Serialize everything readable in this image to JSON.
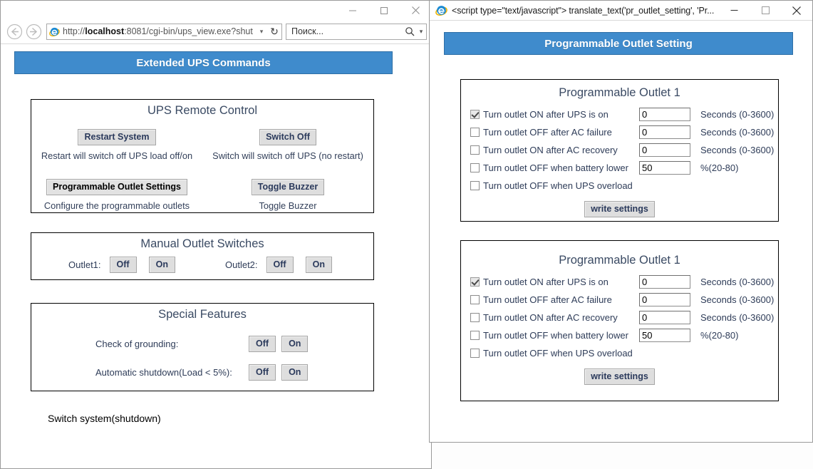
{
  "left_window": {
    "title": "",
    "controls": {
      "minimize": "minimize-icon",
      "maximize": "maximize-icon",
      "close": "close-icon"
    },
    "nav": {
      "back": "back-arrow-icon",
      "forward": "forward-arrow-icon",
      "favicon": "ie-favicon",
      "url_prefix": "http://",
      "url_host": "localhost",
      "url_rest": ":8081/cgi-bin/ups_view.exe?shut",
      "dropdown": "▾",
      "reload": "↻"
    },
    "search": {
      "placeholder": "Поиск...",
      "icon": "search-icon",
      "caret": "▾"
    },
    "page": {
      "banner": "Extended UPS Commands",
      "remote_control": {
        "title": "UPS Remote Control",
        "buttons": [
          {
            "label": "Restart System",
            "caption": "Restart will switch off UPS load off/on",
            "focused": false
          },
          {
            "label": "Switch Off",
            "caption": "Switch will switch off UPS (no restart)",
            "focused": false
          },
          {
            "label": "Programmable Outlet Settings",
            "caption": "Configure the programmable outlets",
            "focused": true
          },
          {
            "label": "Toggle Buzzer",
            "caption": "Toggle Buzzer",
            "focused": false
          }
        ]
      },
      "manual_outlets": {
        "title": "Manual Outlet Switches",
        "rows": [
          {
            "label": "Outlet1:",
            "off": "Off",
            "on": "On"
          },
          {
            "label": "Outlet2:",
            "off": "Off",
            "on": "On"
          }
        ]
      },
      "special_features": {
        "title": "Special Features",
        "rows": [
          {
            "label": "Check of grounding:",
            "off": "Off",
            "on": "On"
          },
          {
            "label": "Automatic shutdown(Load < 5%):",
            "off": "Off",
            "on": "On"
          }
        ]
      },
      "footer_text": "Switch system(shutdown)"
    }
  },
  "right_window": {
    "title": "<script type=\"text/javascript\"> translate_text('pr_outlet_setting', 'Pr...",
    "controls": {
      "minimize": "minimize-icon",
      "maximize": "maximize-icon",
      "close": "close-icon"
    },
    "favicon": "ie-favicon",
    "page": {
      "banner": "Programmable Outlet Setting",
      "panels": [
        {
          "title": "Programmable Outlet 1",
          "options": [
            {
              "label": "Turn outlet ON after UPS is on",
              "checked": true,
              "value": "0",
              "unit": "Seconds (0-3600)",
              "has_input": true
            },
            {
              "label": "Turn outlet OFF after AC failure",
              "checked": false,
              "value": "0",
              "unit": "Seconds (0-3600)",
              "has_input": true
            },
            {
              "label": "Turn outlet ON after AC recovery",
              "checked": false,
              "value": "0",
              "unit": "Seconds (0-3600)",
              "has_input": true
            },
            {
              "label": "Turn outlet OFF when battery lower",
              "checked": false,
              "value": "50",
              "unit": "%(20-80)",
              "has_input": true
            },
            {
              "label": "Turn outlet OFF when UPS overload",
              "checked": false,
              "value": "",
              "unit": "",
              "has_input": false
            }
          ],
          "submit": "write settings"
        },
        {
          "title": "Programmable Outlet 1",
          "options": [
            {
              "label": "Turn outlet ON after UPS is on",
              "checked": true,
              "value": "0",
              "unit": "Seconds (0-3600)",
              "has_input": true
            },
            {
              "label": "Turn outlet OFF after AC failure",
              "checked": false,
              "value": "0",
              "unit": "Seconds (0-3600)",
              "has_input": true
            },
            {
              "label": "Turn outlet ON after AC recovery",
              "checked": false,
              "value": "0",
              "unit": "Seconds (0-3600)",
              "has_input": true
            },
            {
              "label": "Turn outlet OFF when battery lower",
              "checked": false,
              "value": "50",
              "unit": "%(20-80)",
              "has_input": true
            },
            {
              "label": "Turn outlet OFF when UPS overload",
              "checked": false,
              "value": "",
              "unit": "",
              "has_input": false
            }
          ],
          "submit": "write settings"
        }
      ]
    }
  },
  "colors": {
    "banner_blue": "#3f8bcc",
    "banner_border": "#2d6ea6",
    "text_blue": "#2e3c58",
    "button_face": "#dedede"
  }
}
